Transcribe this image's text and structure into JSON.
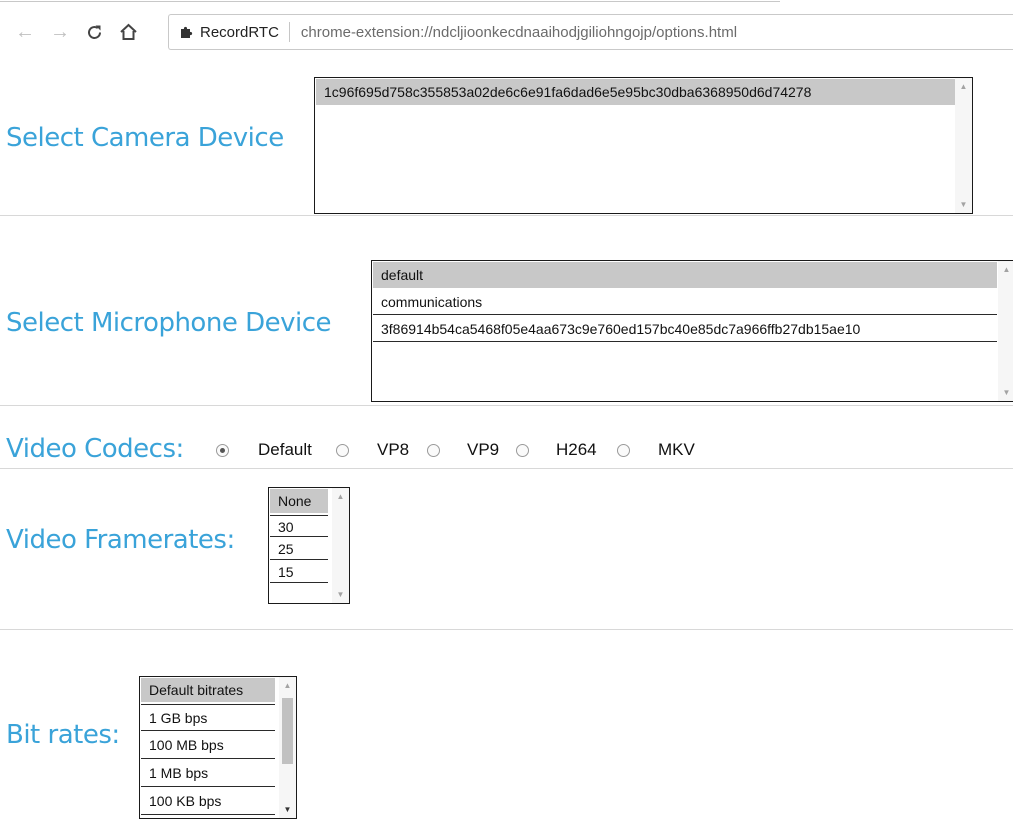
{
  "browser": {
    "site_name": "RecordRTC",
    "url": "chrome-extension://ndcljioonkecdnaaihodjgiliohngojp/options.html",
    "icons": [
      "back-arrow-icon",
      "forward-arrow-icon",
      "reload-icon",
      "home-icon",
      "extension-puzzle-icon"
    ]
  },
  "camera": {
    "label": "Select Camera Device",
    "options": [
      "1c96f695d758c355853a02de6c6e91fa6dad6e5e95bc30dba6368950d6d74278"
    ],
    "selected": "1c96f695d758c355853a02de6c6e91fa6dad6e5e95bc30dba6368950d6d74278"
  },
  "microphone": {
    "label": "Select Microphone Device",
    "options": [
      "default",
      "communications",
      "3f86914b54ca5468f05e4aa673c9e760ed157bc40e85dc7a966ffb27db15ae10"
    ],
    "selected": "default"
  },
  "codecs": {
    "label": "Video Codecs:",
    "options": [
      "Default",
      "VP8",
      "VP9",
      "H264",
      "MKV"
    ],
    "selected": "Default"
  },
  "framerates": {
    "label": "Video Framerates:",
    "options": [
      "None",
      "30",
      "25",
      "15"
    ],
    "selected": "None"
  },
  "bitrates": {
    "label": "Bit rates:",
    "options": [
      "Default bitrates",
      "1 GB bps",
      "100 MB bps",
      "1 MB bps",
      "100 KB bps"
    ],
    "selected": "Default bitrates"
  },
  "colors": {
    "label_blue": "#3aa3d9",
    "selected_option_bg": "#c8c8c8"
  }
}
